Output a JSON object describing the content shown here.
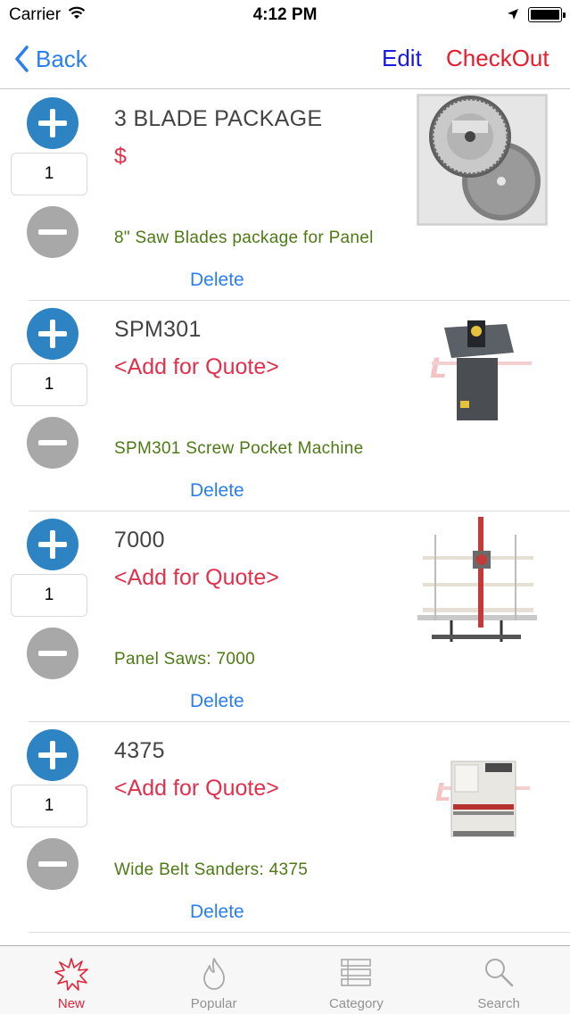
{
  "status": {
    "carrier": "Carrier",
    "time": "4:12 PM"
  },
  "nav": {
    "back_label": "Back",
    "edit_label": "Edit",
    "checkout_label": "CheckOut"
  },
  "items": [
    {
      "title": "3 BLADE PACKAGE",
      "price": "$",
      "quantity": "1",
      "description": "8\" Saw Blades package for Panel",
      "delete_label": "Delete",
      "image": "saw-blades-photo"
    },
    {
      "title": "SPM301",
      "price": "<Add for Quote>",
      "quantity": "1",
      "description": "SPM301 Screw Pocket Machine",
      "delete_label": "Delete",
      "image": "screw-pocket-machine-photo"
    },
    {
      "title": "7000",
      "price": "<Add for Quote>",
      "quantity": "1",
      "description": "Panel Saws: 7000",
      "delete_label": "Delete",
      "image": "panel-saw-photo"
    },
    {
      "title": "4375",
      "price": "<Add for Quote>",
      "quantity": "1",
      "description": "Wide Belt Sanders:  4375",
      "delete_label": "Delete",
      "image": "wide-belt-sander-photo"
    }
  ],
  "tabs": [
    {
      "label": "New",
      "icon": "starburst-icon",
      "active": true
    },
    {
      "label": "Popular",
      "icon": "flame-icon",
      "active": false
    },
    {
      "label": "Category",
      "icon": "list-icon",
      "active": false
    },
    {
      "label": "Search",
      "icon": "magnifier-icon",
      "active": false
    }
  ],
  "colors": {
    "accent_blue": "#2a7ef0",
    "checkout_red": "#e81c2c",
    "price_red": "#e0304c",
    "description_green": "#4d7a14",
    "plus_blue": "#2e83c3",
    "minus_gray": "#a8a8a8"
  }
}
